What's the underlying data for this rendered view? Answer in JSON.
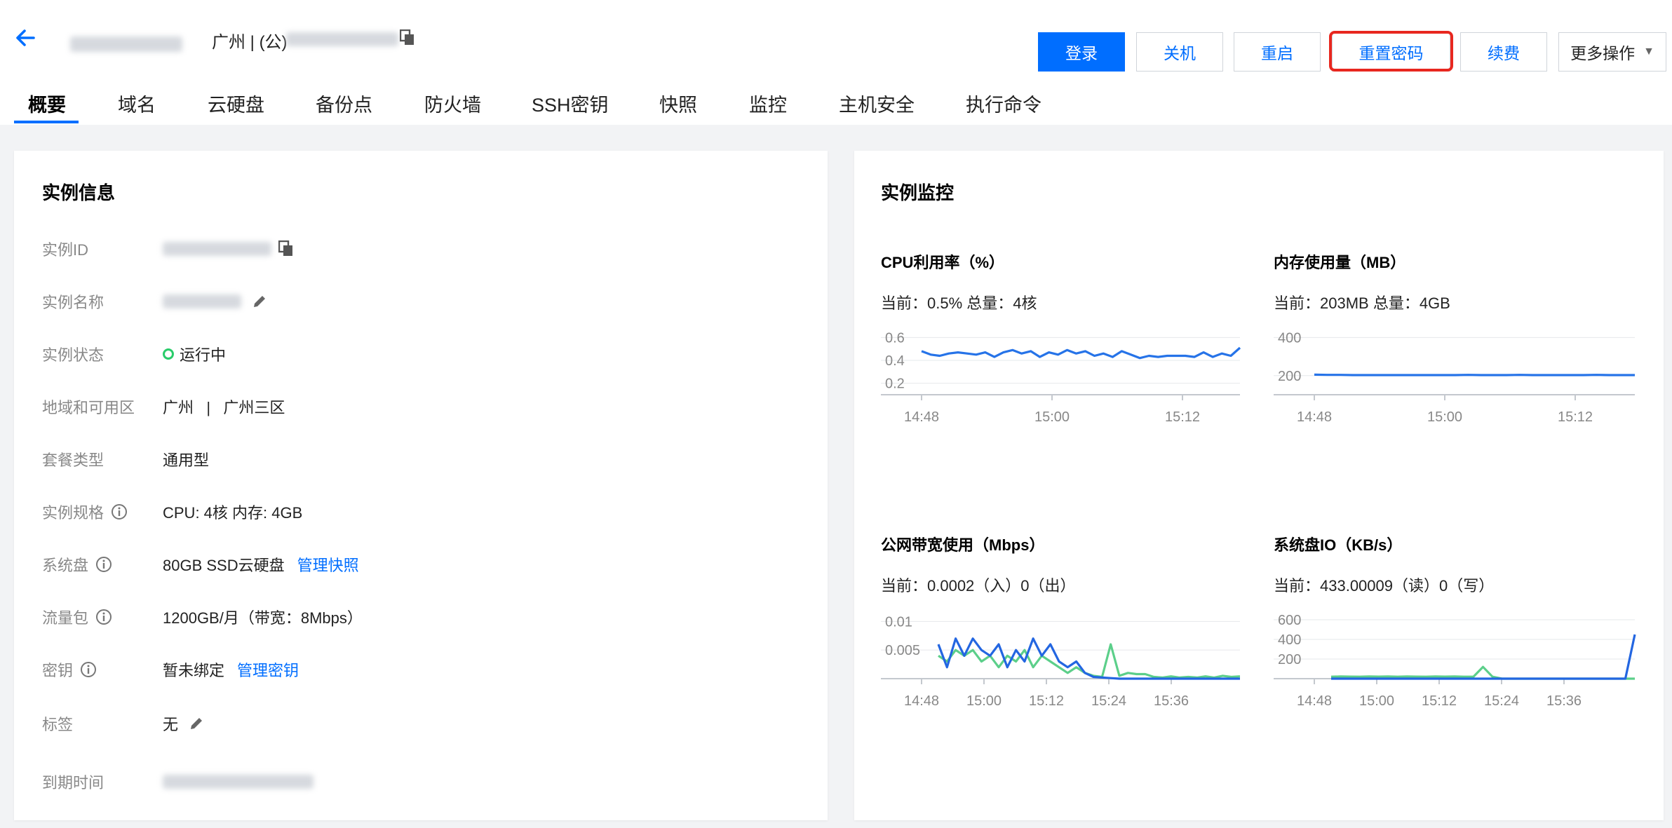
{
  "header": {
    "region": "广州 | (公)",
    "buttons": {
      "login": "登录",
      "shutdown": "关机",
      "restart": "重启",
      "reset_password": "重置密码",
      "renew": "续费",
      "more": "更多操作"
    },
    "tabs": [
      "概要",
      "域名",
      "云硬盘",
      "备份点",
      "防火墙",
      "SSH密钥",
      "快照",
      "监控",
      "主机安全",
      "执行命令"
    ],
    "active_tab": "概要",
    "accent_color": "#006eff",
    "highlight_color": "#e8271f"
  },
  "instance_info": {
    "title": "实例信息",
    "rows": {
      "id_label": "实例ID",
      "name_label": "实例名称",
      "status_label": "实例状态",
      "status_value": "运行中",
      "region_label": "地域和可用区",
      "region_value": "广州   |   广州三区",
      "package_label": "套餐类型",
      "package_value": "通用型",
      "spec_label": "实例规格",
      "spec_value": "CPU: 4核 内存: 4GB",
      "disk_label": "系统盘",
      "disk_value": "80GB SSD云硬盘",
      "disk_link": "管理快照",
      "traffic_label": "流量包",
      "traffic_value": "1200GB/月（带宽：8Mbps）",
      "key_label": "密钥",
      "key_value": "暂未绑定",
      "key_link": "管理密钥",
      "tag_label": "标签",
      "tag_value": "无",
      "expire_label": "到期时间"
    }
  },
  "monitor": {
    "title": "实例监控",
    "cpu": {
      "title": "CPU利用率（%）",
      "current": "当前：0.5% 总量：4核"
    },
    "mem": {
      "title": "内存使用量（MB）",
      "current": "当前：203MB 总量：4GB"
    },
    "net": {
      "title": "公网带宽使用（Mbps）",
      "current": "当前：0.0002（入）0（出）"
    },
    "disk": {
      "title": "系统盘IO（KB/s）",
      "current": "当前：433.00009（读）0（写）"
    }
  },
  "chart_data": [
    {
      "type": "line",
      "yticks": [
        "0.6",
        "0.4",
        "0.2"
      ],
      "xticks": [
        "14:48",
        "15:00",
        "15:12"
      ],
      "ylim": [
        0.1,
        0.7
      ],
      "series": [
        {
          "color": "#2673e8",
          "values": [
            0.48,
            0.45,
            0.44,
            0.46,
            0.47,
            0.46,
            0.45,
            0.47,
            0.43,
            0.47,
            0.49,
            0.46,
            0.48,
            0.43,
            0.47,
            0.45,
            0.49,
            0.46,
            0.48,
            0.44,
            0.46,
            0.43,
            0.48,
            0.45,
            0.42,
            0.44,
            0.43,
            0.44,
            0.44,
            0.44,
            0.43,
            0.47,
            0.43,
            0.46,
            0.44,
            0.51
          ]
        }
      ]
    },
    {
      "type": "line",
      "yticks": [
        "400",
        "200"
      ],
      "xticks": [
        "14:48",
        "15:00",
        "15:12"
      ],
      "ylim": [
        100,
        460
      ],
      "series": [
        {
          "color": "#2673e8",
          "values": [
            205,
            204,
            204,
            203,
            203,
            203,
            203,
            203,
            203,
            203,
            203,
            203,
            204,
            203,
            203,
            203,
            204,
            203,
            203,
            203,
            203,
            203,
            204,
            203,
            203,
            203
          ]
        }
      ]
    },
    {
      "type": "line",
      "yticks": [
        "0.01",
        "0.005"
      ],
      "xticks": [
        "14:48",
        "15:00",
        "15:12",
        "15:24",
        "15:36"
      ],
      "ylim": [
        0,
        0.012
      ],
      "series": [
        {
          "color": "#5ccf8a",
          "values": [
            0.004,
            0.003,
            0.005,
            0.004,
            0.005,
            0.003,
            0.004,
            0.002,
            0.004,
            0.003,
            0.005,
            0.002,
            0.004,
            0.003,
            0.002,
            0.001,
            0.002,
            0.001,
            0.0005,
            0.0003,
            0.006,
            0.0005,
            0.001,
            0.0008,
            0.0008,
            0.0003,
            0.0002,
            0.0004,
            0.0002,
            0.0003,
            0.0002,
            0.0004,
            0.0002,
            0.0005,
            0.0003,
            0.0004
          ]
        },
        {
          "color": "#2366e1",
          "values": [
            0.006,
            0.002,
            0.007,
            0.004,
            0.007,
            0.005,
            0.004,
            0.006,
            0.002,
            0.005,
            0.003,
            0.007,
            0.004,
            0.006,
            0.003,
            0.002,
            0.003,
            0.001,
            0.0003,
            0.0002,
            0.0001,
            0,
            0,
            0,
            0,
            0,
            0,
            0,
            0,
            0,
            0,
            0,
            0,
            0,
            0,
            0
          ]
        }
      ]
    },
    {
      "type": "line",
      "yticks": [
        "600",
        "400",
        "200"
      ],
      "xticks": [
        "14:48",
        "15:00",
        "15:12",
        "15:24",
        "15:36"
      ],
      "ylim": [
        0,
        700
      ],
      "series": [
        {
          "color": "#5ccf8a",
          "values": [
            20,
            22,
            21,
            20,
            22,
            21,
            23,
            20,
            22,
            21,
            20,
            23,
            21,
            22,
            20,
            21,
            120,
            20,
            0,
            0,
            0,
            0,
            0,
            0,
            0,
            0,
            0,
            0,
            0,
            0,
            0,
            0,
            0
          ]
        },
        {
          "color": "#2366e1",
          "values": [
            0,
            0,
            0,
            0,
            0,
            0,
            0,
            0,
            0,
            0,
            0,
            0,
            0,
            0,
            0,
            0,
            0,
            0,
            0,
            0,
            0,
            0,
            0,
            0,
            0,
            0,
            0,
            0,
            0,
            0,
            0,
            0,
            450
          ]
        }
      ]
    }
  ]
}
